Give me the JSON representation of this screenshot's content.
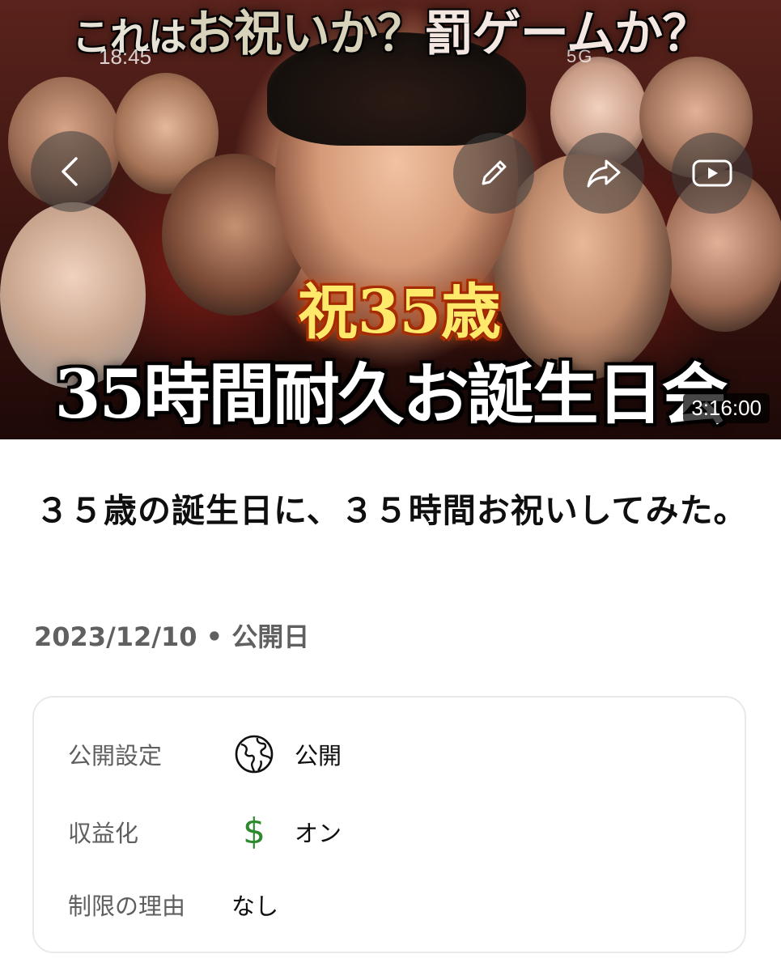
{
  "thumbnail": {
    "top_caption_a": "これは",
    "top_caption_b": "お祝いか？",
    "top_caption_c": "罰ゲームか？",
    "badge": "祝35歳",
    "bottom_caption": "35時間耐久お誕生日会",
    "duration": "3:16:00",
    "status_time": "18:45",
    "status_network": "5G"
  },
  "overlay": {
    "back_icon": "chevron-left-icon",
    "edit_icon": "pencil-icon",
    "share_icon": "share-arrow-icon",
    "youtube_icon": "youtube-play-icon"
  },
  "video": {
    "title": "３５歳の誕生日に、３５時間お祝いしてみた。",
    "date": "2023/12/10",
    "separator": "•",
    "date_label": "公開日"
  },
  "details": {
    "visibility": {
      "label": "公開設定",
      "icon": "globe-icon",
      "value": "公開"
    },
    "monetization": {
      "label": "収益化",
      "icon": "dollar-icon",
      "icon_glyph": "$",
      "value": "オン",
      "color": "#2c8a2c"
    },
    "restriction": {
      "label": "制限の理由",
      "value": "なし"
    }
  }
}
